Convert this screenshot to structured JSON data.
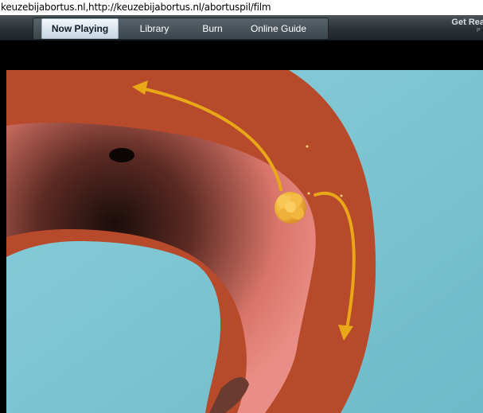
{
  "address_bar": {
    "url_text": "keuzebijabortus.nl,http://keuzebijabortus.nl/abortuspil/film"
  },
  "toolbar": {
    "tabs": [
      {
        "label": "Now Playing",
        "active": true
      },
      {
        "label": "Library",
        "active": false
      },
      {
        "label": "Burn",
        "active": false
      },
      {
        "label": "Online Guide",
        "active": false
      }
    ],
    "get_real_label": "Get Rea",
    "get_real_sub": "P"
  },
  "colors": {
    "uterus": "#b84a2c",
    "background_fluid": "#7ec6d2",
    "arrow": "#e8a817",
    "embryo": "#f0b23a"
  },
  "video": {
    "icons": [
      "arrow-left-icon",
      "arrow-down-icon",
      "embryo-icon"
    ]
  }
}
